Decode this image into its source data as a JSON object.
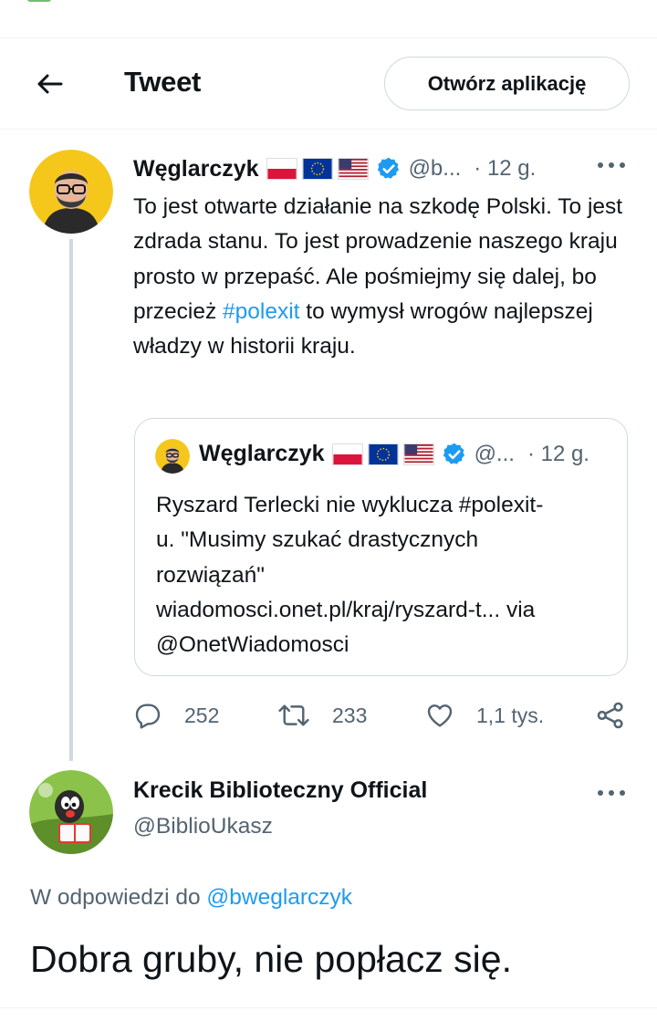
{
  "header": {
    "title": "Tweet",
    "open_app_label": "Otwórz aplikację"
  },
  "tweet": {
    "author_name": "Węglarczyk",
    "handle": "@b...",
    "time": "· 12 g.",
    "flags": [
      "pl",
      "eu",
      "us"
    ],
    "text_part1": "To jest otwarte działanie na szkodę Polski. To jest zdrada stanu. To jest prowadzenie naszego kraju prosto w przepaść. Ale pośmiejmy się dalej, bo przecież ",
    "hashtag": "#polexit",
    "text_part2": " to wymysł wrogów najlepszej władzy w historii kraju.",
    "quote": {
      "author_name": "Węglarczyk",
      "handle": "@...",
      "time": "· 12 g.",
      "line1": "Ryszard Terlecki nie wyklucza #polexit-",
      "line2": "u. \"Musimy szukać drastycznych",
      "line3": "rozwiązań\"",
      "line4": "wiadomosci.onet.pl/kraj/ryszard-t... via",
      "line5": "@OnetWiadomosci"
    },
    "stats": {
      "replies": "252",
      "retweets": "233",
      "likes": "1,1 tys."
    }
  },
  "reply": {
    "author_name": "Krecik Biblioteczny Official",
    "handle": "@BiblioUkasz",
    "in_reply_prefix": "W odpowiedzi do ",
    "in_reply_mention": "@bweglarczyk",
    "text": "Dobra gruby, nie popłacz się."
  },
  "colors": {
    "accent": "#1d9bf0",
    "secondary_text": "#536471",
    "border": "#cfd9de"
  }
}
